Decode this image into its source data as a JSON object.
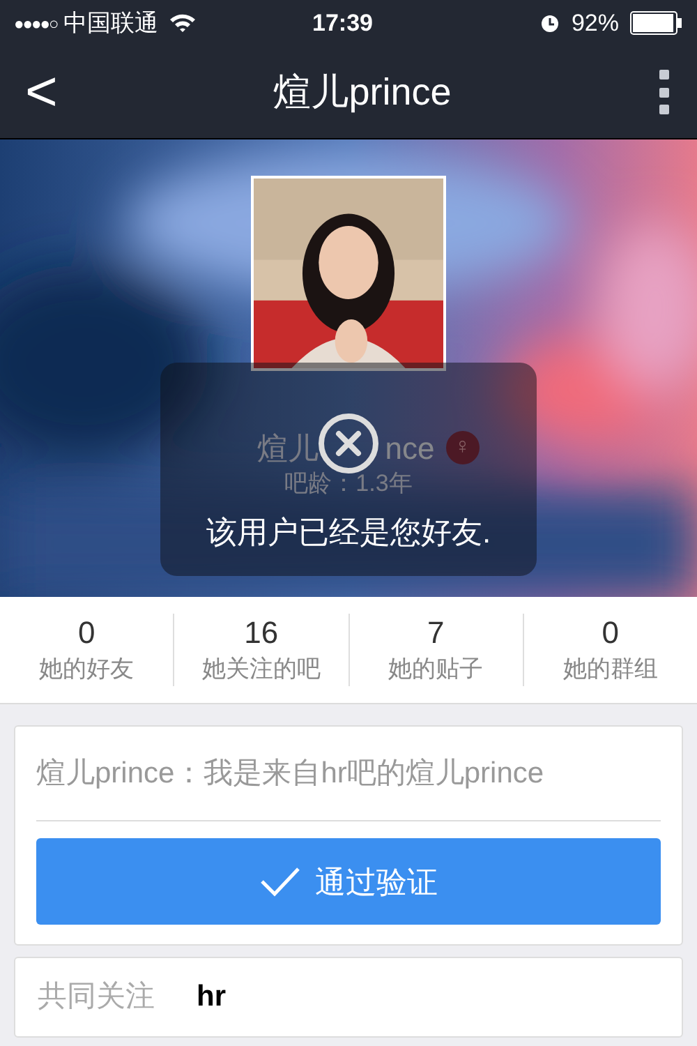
{
  "status_bar": {
    "signal_dots": "●●●●○",
    "carrier": "中国联通",
    "time": "17:39",
    "battery": "92%"
  },
  "nav": {
    "back": "<",
    "title": "煊儿prince"
  },
  "profile": {
    "name_start": "煊儿",
    "name_end": "nce",
    "age": "吧龄：1.3年",
    "gender_symbol": "♀"
  },
  "toast": {
    "message": "该用户已经是您好友."
  },
  "stats": [
    {
      "value": "0",
      "label": "她的好友"
    },
    {
      "value": "16",
      "label": "她关注的吧"
    },
    {
      "value": "7",
      "label": "她的贴子"
    },
    {
      "value": "0",
      "label": "她的群组"
    }
  ],
  "request": {
    "message": "煊儿prince：我是来自hr吧的煊儿prince",
    "button": "通过验证"
  },
  "common": {
    "label": "共同关注",
    "value": "hr"
  }
}
